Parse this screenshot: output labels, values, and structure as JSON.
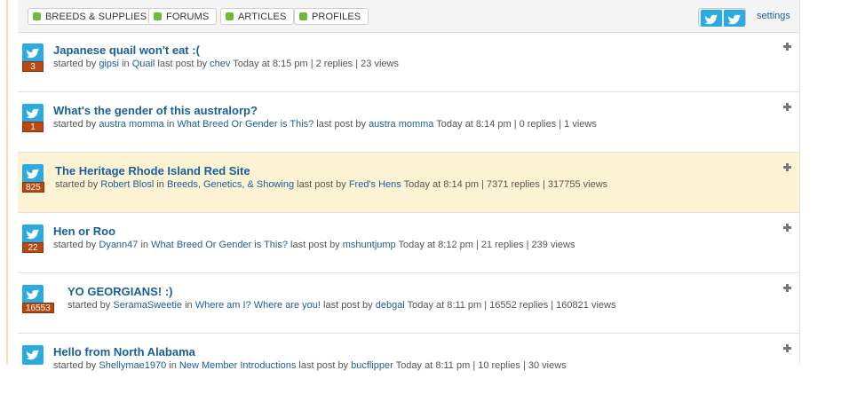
{
  "nav": {
    "tabs": [
      {
        "label": "BREEDS & SUPPLIES"
      },
      {
        "label": "FORUMS"
      },
      {
        "label": "ARTICLES"
      },
      {
        "label": "PROFILES"
      }
    ],
    "settings_label": "settings"
  },
  "colors": {
    "accent_link": "#1a5e9a",
    "icon_blue": "#2ba9e1",
    "badge_brown": "#b8480f",
    "highlight_row": "#fcf3d4",
    "tab_dot": "#6dbb3a"
  },
  "threads": [
    {
      "badge": "3",
      "title": "Japanese quail won't eat :(",
      "started_label": "started by",
      "author": "gipsi",
      "in_label": "in",
      "forum": "Quail",
      "last_label": "last post by",
      "last_user": "chev",
      "stats": "Today at 8:15 pm | 2 replies | 23 views"
    },
    {
      "badge": "1",
      "title": "What's the gender of this australorp?",
      "started_label": "started by",
      "author": "austra momma",
      "in_label": "in",
      "forum": "What Breed Or Gender is This?",
      "last_label": "last post by",
      "last_user": "austra momma",
      "stats": "Today at 8:14 pm | 0 replies | 1 views"
    },
    {
      "badge": "825",
      "title": "The Heritage Rhode Island Red Site",
      "started_label": "started by",
      "author": "Robert Blosl",
      "in_label": "in",
      "forum": "Breeds, Genetics, & Showing",
      "last_label": "last post by",
      "last_user": "Fred's Hens",
      "stats": "Today at 8:14 pm | 7371 replies | 317755 views"
    },
    {
      "badge": "22",
      "title": "Hen or Roo",
      "started_label": "started by",
      "author": "Dyann47",
      "in_label": "in",
      "forum": "What Breed Or Gender is This?",
      "last_label": "last post by",
      "last_user": "mshuntjump",
      "stats": "Today at 8:12 pm | 21 replies | 239 views"
    },
    {
      "badge": "16553",
      "title": "YO GEORGIANS! :)",
      "started_label": "started by",
      "author": "SeramaSweetie",
      "in_label": "in",
      "forum": "Where am I? Where are you!",
      "last_label": "last post by",
      "last_user": "debgal",
      "stats": "Today at 8:11 pm | 16552 replies | 160821 views"
    },
    {
      "badge": "",
      "title": "Hello from North Alabama",
      "started_label": "started by",
      "author": "Shellymae1970",
      "in_label": "in",
      "forum": "New Member Introductions",
      "last_label": "last post by",
      "last_user": "bucflipper",
      "stats": "Today at 8:11 pm | 10 replies | 30 views"
    }
  ]
}
